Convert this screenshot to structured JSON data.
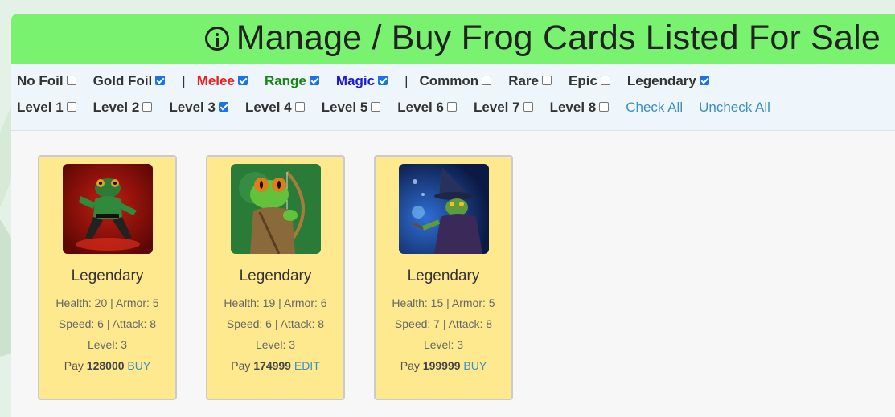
{
  "header": {
    "title": "Manage / Buy Frog Cards Listed For Sale"
  },
  "filters": {
    "row1": [
      {
        "label": "No Foil",
        "checked": false,
        "color": "#333333"
      },
      {
        "label": "Gold Foil",
        "checked": true,
        "color": "#333333"
      },
      {
        "sep": "|"
      },
      {
        "label": "Melee",
        "checked": true,
        "color": "#e8221f"
      },
      {
        "label": "Range",
        "checked": true,
        "color": "#168516"
      },
      {
        "label": "Magic",
        "checked": true,
        "color": "#1a1ad6"
      },
      {
        "sep": "|"
      },
      {
        "label": "Common",
        "checked": false,
        "color": "#333333"
      },
      {
        "label": "Rare",
        "checked": false,
        "color": "#333333"
      },
      {
        "label": "Epic",
        "checked": false,
        "color": "#333333"
      },
      {
        "label": "Legendary",
        "checked": true,
        "color": "#333333"
      }
    ],
    "row2": [
      {
        "label": "Level 1",
        "checked": false
      },
      {
        "label": "Level 2",
        "checked": false
      },
      {
        "label": "Level 3",
        "checked": true
      },
      {
        "label": "Level 4",
        "checked": false
      },
      {
        "label": "Level 5",
        "checked": false
      },
      {
        "label": "Level 6",
        "checked": false
      },
      {
        "label": "Level 7",
        "checked": false
      },
      {
        "label": "Level 8",
        "checked": false
      }
    ],
    "check_all": "Check All",
    "uncheck_all": "Uncheck All"
  },
  "cards": [
    {
      "art": "red-ninja-frog",
      "rarity": "Legendary",
      "stats1": "Health: 20 | Armor: 5",
      "stats2": "Speed: 6 | Attack: 8",
      "level": "Level: 3",
      "pay_label": "Pay",
      "price": "128000",
      "action": "BUY"
    },
    {
      "art": "archer-frog",
      "rarity": "Legendary",
      "stats1": "Health: 19 | Armor: 6",
      "stats2": "Speed: 6 | Attack: 8",
      "level": "Level: 3",
      "pay_label": "Pay",
      "price": "174999",
      "action": "EDIT"
    },
    {
      "art": "wizard-frog",
      "rarity": "Legendary",
      "stats1": "Health: 15 | Armor: 5",
      "stats2": "Speed: 7 | Attack: 8",
      "level": "Level: 3",
      "pay_label": "Pay",
      "price": "199999",
      "action": "BUY"
    }
  ]
}
